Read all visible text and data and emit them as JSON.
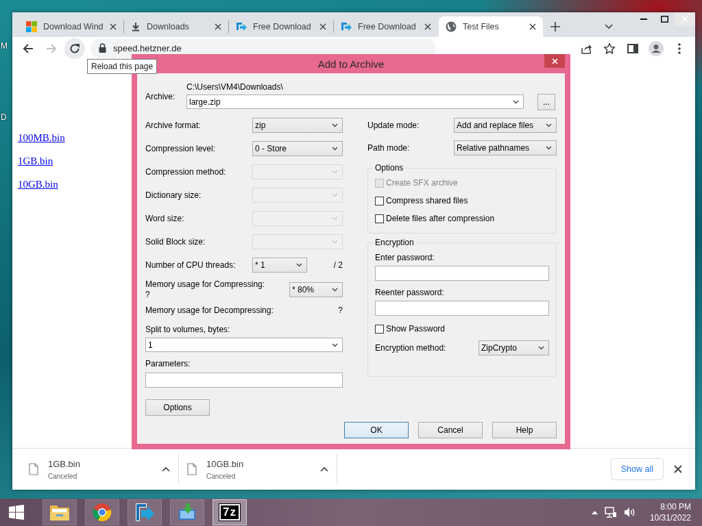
{
  "desktop_labels": [
    "M",
    "D"
  ],
  "browser": {
    "tabs": [
      {
        "title": "Download Wind",
        "kind": "windows",
        "selected": false
      },
      {
        "title": "Downloads",
        "kind": "download",
        "selected": false
      },
      {
        "title": "Free Download",
        "kind": "fdm",
        "selected": false
      },
      {
        "title": "Free Download",
        "kind": "fdm",
        "selected": false
      },
      {
        "title": "Test Files",
        "kind": "globe",
        "selected": true
      }
    ],
    "address": "speed.hetzner.de",
    "tooltip": "Reload this page",
    "links": [
      "100MB.bin",
      "1GB.bin",
      "10GB.bin"
    ],
    "downloads": [
      {
        "name": "1GB.bin",
        "status": "Canceled"
      },
      {
        "name": "10GB.bin",
        "status": "Canceled"
      }
    ],
    "show_all": "Show all"
  },
  "dialog": {
    "title": "Add to Archive",
    "archive": {
      "label": "Archive:",
      "folder": "C:\\Users\\VM4\\Downloads\\",
      "value": "large.zip",
      "browse": "..."
    },
    "left_rows": [
      {
        "kind": "select",
        "label": "Archive format:",
        "value": "zip",
        "disabled": false
      },
      {
        "kind": "select",
        "label": "Compression level:",
        "value": "0 - Store",
        "disabled": false
      },
      {
        "kind": "select",
        "label": "Compression method:",
        "disabled": true
      },
      {
        "kind": "select",
        "label": "Dictionary size:",
        "disabled": true
      },
      {
        "kind": "select",
        "label": "Word size:",
        "disabled": true
      },
      {
        "kind": "select",
        "label": "Solid Block size:",
        "disabled": true
      },
      {
        "kind": "threads",
        "label": "Number of CPU threads:",
        "value": "* 1",
        "note": "/ 2",
        "disabled": false
      },
      {
        "kind": "memory",
        "label": "Memory usage for Compressing:",
        "note": "?",
        "value": "* 80%",
        "disabled": false
      },
      {
        "kind": "info",
        "label": "Memory usage for Decompressing:",
        "note": "?"
      }
    ],
    "split": {
      "label": "Split to volumes, bytes:",
      "value": "1"
    },
    "parameters": {
      "label": "Parameters:"
    },
    "options_button": "Options",
    "right_rows": [
      {
        "label": "Update mode:",
        "value": "Add and replace files"
      },
      {
        "label": "Path mode:",
        "value": "Relative pathnames"
      }
    ],
    "options": {
      "title": "Options",
      "checkboxes": [
        {
          "label": "Create SFX archive",
          "checked": false,
          "disabled": true
        },
        {
          "label": "Compress shared files",
          "checked": false,
          "disabled": false
        },
        {
          "label": "Delete files after compression",
          "checked": false,
          "disabled": false
        }
      ]
    },
    "encryption": {
      "title": "Encryption",
      "password_label": "Enter password:",
      "reenter_label": "Reenter password:",
      "show_password": {
        "label": "Show Password",
        "checked": false,
        "disabled": false
      },
      "method_label": "Encryption method:",
      "method": "ZipCrypto"
    },
    "buttons": [
      {
        "label": "OK",
        "default": true
      },
      {
        "label": "Cancel",
        "default": false
      },
      {
        "label": "Help",
        "default": false
      }
    ]
  },
  "taskbar": {
    "apps": [
      {
        "kind": "folder",
        "selected": false
      },
      {
        "kind": "chrome",
        "selected": false
      },
      {
        "kind": "transfer",
        "selected": false
      },
      {
        "kind": "installer",
        "selected": false
      },
      {
        "kind": "archiver",
        "label": "7z",
        "selected": true
      }
    ],
    "time": "8:00 PM",
    "date": "10/31/2022"
  }
}
